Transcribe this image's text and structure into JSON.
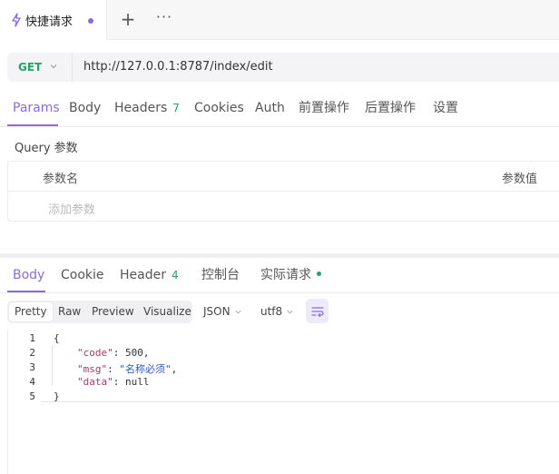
{
  "tab": {
    "title": "快捷请求",
    "icon": "bolt-icon",
    "unsaved_color": "#8b6ad9"
  },
  "tab_actions": {
    "add": "+",
    "more": "···"
  },
  "request": {
    "method": "GET",
    "url": "http://127.0.0.1:8787/index/edit"
  },
  "request_tabs": [
    {
      "label": "Params"
    },
    {
      "label": "Body"
    },
    {
      "label": "Headers",
      "count": "7"
    },
    {
      "label": "Cookies"
    },
    {
      "label": "Auth"
    },
    {
      "label": "前置操作"
    },
    {
      "label": "后置操作"
    },
    {
      "label": "设置"
    }
  ],
  "params": {
    "section_title": "Query 参数",
    "col_name": "参数名",
    "col_value": "参数值",
    "add_placeholder": "添加参数"
  },
  "response_tabs": [
    {
      "label": "Body"
    },
    {
      "label": "Cookie"
    },
    {
      "label": "Header",
      "count": "4"
    },
    {
      "label": "控制台"
    },
    {
      "label": "实际请求"
    }
  ],
  "toolbar": {
    "views": [
      "Pretty",
      "Raw",
      "Preview",
      "Visualize"
    ],
    "format": "JSON",
    "encoding": "utf8"
  },
  "code": {
    "line_numbers": [
      "1",
      "2",
      "3",
      "4",
      "5"
    ],
    "open": "{",
    "close": "}",
    "fields": [
      {
        "key": "\"code\"",
        "value": "500",
        "type": "number",
        "sep": ","
      },
      {
        "key": "\"msg\"",
        "value": "\"名称必须\"",
        "type": "string",
        "sep": ","
      },
      {
        "key": "\"data\"",
        "value": "null",
        "type": "null",
        "sep": ""
      }
    ]
  },
  "colors": {
    "accent": "#8b6ad9",
    "success": "#24a366"
  }
}
